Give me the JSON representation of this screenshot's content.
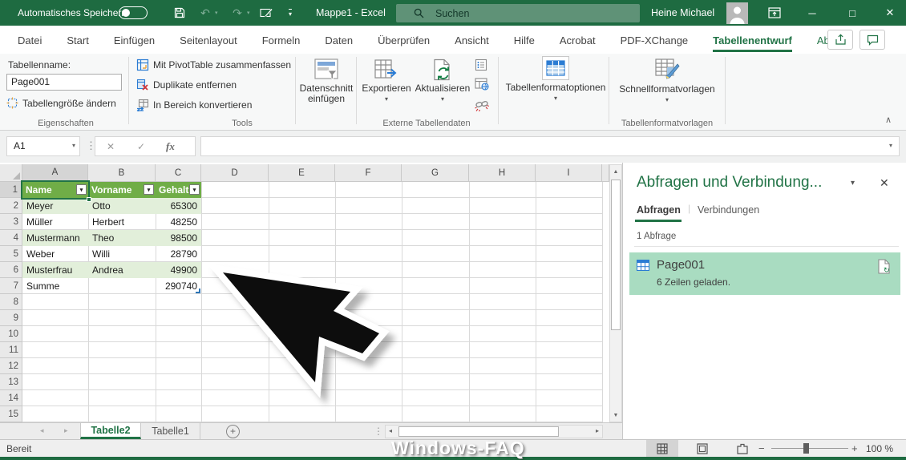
{
  "colors": {
    "titlebar": "#1E6B41",
    "accent": "#217346",
    "tableheader": "#70AD47",
    "band": "#E2EFDA",
    "highlight": "#A9DCC1",
    "disabled": "#7FAE97"
  },
  "window": {
    "autosave_label": "Automatisches Speichern",
    "title": "Mappe1 - Excel",
    "search_placeholder": "Suchen",
    "user_name": "Heine Michael"
  },
  "icons": {
    "undo": "↶",
    "redo": "↷",
    "dropdown": "▾",
    "filter": "▾",
    "minimize": "─",
    "maximize": "□",
    "close": "✕",
    "check": "✓",
    "cancel": "✕",
    "up": "▲",
    "down": "▼",
    "left": "◄",
    "right": "►",
    "tri_left": "◂",
    "tri_right": "▸",
    "dots": "⋮",
    "plus": "+",
    "collapse": "∧",
    "refresh": "↻",
    "minus": "−"
  },
  "ribbon_tabs": [
    "Datei",
    "Start",
    "Einfügen",
    "Seitenlayout",
    "Formeln",
    "Daten",
    "Überprüfen",
    "Ansicht",
    "Hilfe",
    "Acrobat",
    "PDF-XChange",
    "Tabellenentwurf",
    "Abfrage"
  ],
  "ribbon": {
    "properties": {
      "group_label": "Eigenschaften",
      "table_name_label": "Tabellenname:",
      "table_name_value": "Page001",
      "resize_button": "Tabellengröße ändern"
    },
    "tools": {
      "group_label": "Tools",
      "pivot": "Mit PivotTable zusammenfassen",
      "duplicates": "Duplikate entfernen",
      "convert": "In Bereich konvertieren",
      "slicer_line1": "Datenschnitt",
      "slicer_line2": "einfügen"
    },
    "external": {
      "group_label": "Externe Tabellendaten",
      "export": "Exportieren",
      "refresh": "Aktualisieren"
    },
    "options": {
      "button": "Tabellenformatoptionen"
    },
    "styles": {
      "group_label": "Tabellenformatvorlagen",
      "quick_styles": "Schnellformatvorlagen"
    }
  },
  "formula_bar": {
    "name_box": "A1",
    "fx": "fx"
  },
  "grid": {
    "columns": [
      "A",
      "B",
      "C",
      "D",
      "E",
      "F",
      "G",
      "H",
      "I"
    ],
    "row_numbers": [
      "1",
      "2",
      "3",
      "4",
      "5",
      "6",
      "7",
      "8",
      "9",
      "10",
      "11",
      "12",
      "13",
      "14",
      "15"
    ],
    "table": {
      "headers": [
        "Name",
        "Vorname",
        "Gehalt"
      ],
      "rows": [
        [
          "Meyer",
          "Otto",
          "65300"
        ],
        [
          "Müller",
          "Herbert",
          "48250"
        ],
        [
          "Mustermann",
          "Theo",
          "98500"
        ],
        [
          "Weber",
          "Willi",
          "28790"
        ],
        [
          "Musterfrau",
          "Andrea",
          "49900"
        ],
        [
          "Summe",
          "",
          "290740"
        ]
      ]
    }
  },
  "pane": {
    "title": "Abfragen und Verbindung...",
    "tab_queries": "Abfragen",
    "tab_connections": "Verbindungen",
    "count_label": "1 Abfrage",
    "query_name": "Page001",
    "query_status": "6 Zeilen geladen."
  },
  "sheet_bar": {
    "tab1": "Tabelle2",
    "tab2": "Tabelle1"
  },
  "status_bar": {
    "ready": "Bereit",
    "zoom_level": "100 %"
  },
  "watermark": "Windows-FAQ"
}
